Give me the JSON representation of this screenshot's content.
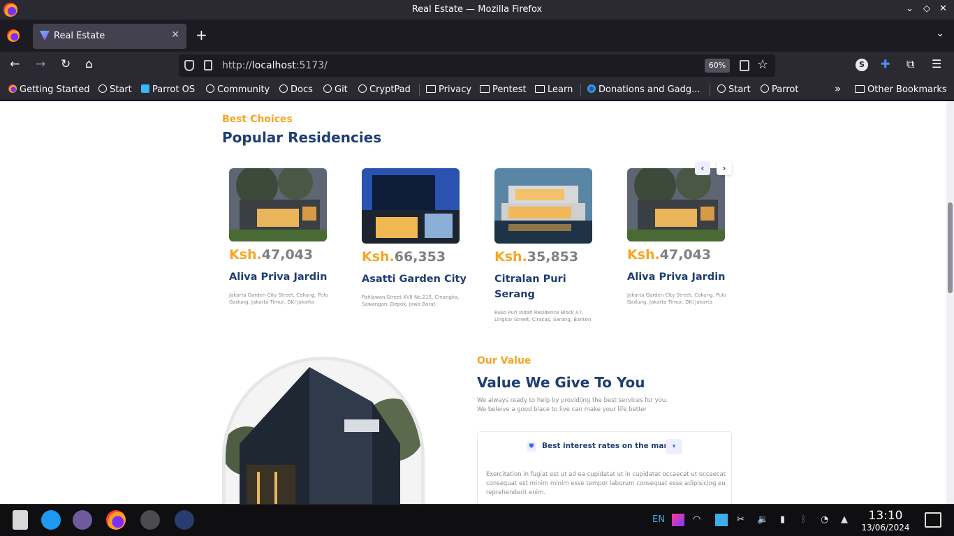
{
  "window": {
    "title": "Real Estate — Mozilla Firefox"
  },
  "tab": {
    "label": "Real Estate"
  },
  "nav": {
    "url_scheme": "http://",
    "url_host": "localhost",
    "url_rest": ":5173/",
    "zoom": "60%"
  },
  "bookmarks": [
    "Getting Started",
    "Start",
    "Parrot OS",
    "Community",
    "Docs",
    "Git",
    "CryptPad",
    "Privacy",
    "Pentest",
    "Learn",
    "Donations and Gadg...",
    "Start",
    "Parrot"
  ],
  "other_bookmarks": "Other Bookmarks",
  "residencies": {
    "eyebrow": "Best Choices",
    "title": "Popular Residencies",
    "currency": "Ksh.",
    "cards": [
      {
        "price": "47,043",
        "name": "Aliva Priva Jardin",
        "address": "Jakarta Garden City Street, Cakung. Pulo Gadung, Jakarta Timur, DKI Jakarta"
      },
      {
        "price": "66,353",
        "name": "Asatti Garden City",
        "address": "Pahlawan Street XVII No.215, Cinangka, Sawangan, Depok, Jawa Barat"
      },
      {
        "price": "35,853",
        "name": "Citralan Puri Serang",
        "address": "Ruko Puri Indah Residence Block A7, Lingkar Street, Ciracas, Serang, Banten"
      },
      {
        "price": "47,043",
        "name": "Aliva Priva Jardin",
        "address": "Jakarta Garden City Street, Cakung. Pulo Gadung, Jakarta Timur, DKI Jakarta"
      }
    ],
    "prev": "‹",
    "next": "›"
  },
  "value": {
    "eyebrow": "Our Value",
    "title": "Value We Give To You",
    "desc_line1": "We always ready to help by providijng the best services for you.",
    "desc_line2": "We beleive a good blace to live can make your life better",
    "accordion_title": "Best interest rates on the market",
    "accordion_body": "Exercitation in fugiat est ut ad ea cupidatat ut in cupidatat occaecat ut occaecat consequat est minim minim esse tempor laborum consequat esse adipisicing eu reprehenderit enim."
  },
  "taskbar": {
    "lang": "EN",
    "time": "13:10",
    "date": "13/06/2024"
  }
}
